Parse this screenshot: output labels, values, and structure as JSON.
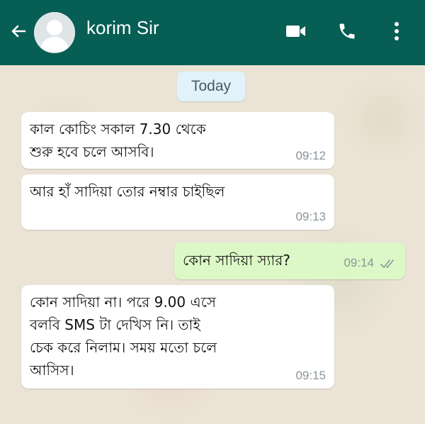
{
  "header": {
    "back_icon": "arrow-left-icon",
    "contact_name": "korim Sir",
    "avatar_icon": "default-avatar-icon",
    "video_icon": "video-call-icon",
    "call_icon": "phone-icon",
    "menu_icon": "more-vert-icon",
    "background_color": "#075e54"
  },
  "date_separator": "Today",
  "messages": [
    {
      "direction": "incoming",
      "text": "কাল কোচিং সকাল 7.30 থেকে\nশুরু হবে চলে আসবি।",
      "time": "09:12"
    },
    {
      "direction": "incoming",
      "text": "আর হাঁ সাদিয়া তোর নম্বার চাইছিল",
      "time": "09:13"
    },
    {
      "direction": "outgoing",
      "text": "কোন সাদিয়া স্যার?",
      "time": "09:14",
      "status_icon": "double-check-icon"
    },
    {
      "direction": "incoming",
      "text": "কোন সাদিয়া না। পরে 9.00 এসে\nবলবি SMS টা দেখিস নি। তাই\nচেক করে নিলাম। সময় মতো চলে\nআসিস।",
      "time": "09:15"
    }
  ]
}
